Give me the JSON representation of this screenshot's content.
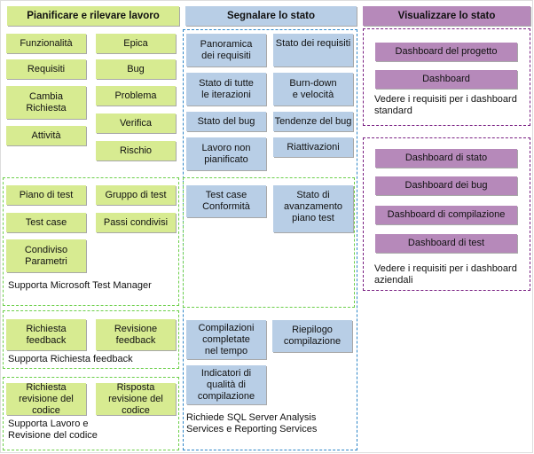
{
  "columns": {
    "plan": {
      "title": "Pianificare e rilevare lavoro"
    },
    "report": {
      "title": "Segnalare lo stato"
    },
    "view": {
      "title": "Visualizzare lo stato"
    }
  },
  "work_items": [
    "Funzionalità",
    "Epica",
    "Requisiti",
    "Bug",
    "Cambia Richiesta",
    "Problema",
    "Verifica",
    "Attività",
    "Rischio"
  ],
  "test_items": [
    "Piano di test",
    "Gruppo di test",
    "Test case",
    "Passi condivisi",
    "Condiviso Parametri"
  ],
  "test_note": "Supporta Microsoft Test Manager",
  "feedback_items": [
    "Richiesta feedback",
    "Revisione feedback"
  ],
  "feedback_note": "Supporta Richiesta feedback",
  "code_review_items": [
    "Richiesta revisione del codice",
    "Risposta revisione del codice"
  ],
  "code_review_note": "Supporta Lavoro e Revisione del codice",
  "reports": [
    "Panoramica dei requisiti",
    "Stato dei requisiti",
    "Stato di tutte le iterazioni",
    "Burn-down e velocità",
    "Stato del bug",
    "Tendenze del bug",
    "Lavoro non pianificato",
    "Riattivazioni"
  ],
  "test_reports": [
    "Test case Conformità",
    "Stato di avanzamento piano test"
  ],
  "build_reports": [
    "Compilazioni completate nel tempo",
    "Riepilogo compilazione",
    "Indicatori di qualità di compilazione"
  ],
  "report_note": "Richiede SQL Server Analysis Services e Reporting Services",
  "standard_dashboards": [
    "Dashboard del progetto",
    "Dashboard"
  ],
  "standard_note": "Vedere i requisiti per i dashboard standard",
  "enterprise_dashboards": [
    "Dashboard di stato",
    "Dashboard dei bug",
    "Dashboard di compilazione",
    "Dashboard di test"
  ],
  "enterprise_note": "Vedere i requisiti per i dashboard aziendali",
  "colors": {
    "green": "#d7eb91",
    "blue": "#b8cee6",
    "purple": "#b689ba"
  }
}
